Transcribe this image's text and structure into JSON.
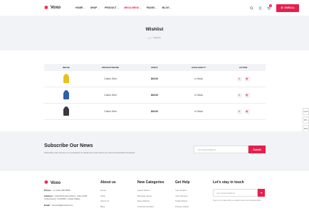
{
  "header": {
    "logo_text": "Voxo",
    "nav": [
      {
        "label": "Home"
      },
      {
        "label": "Shop"
      },
      {
        "label": "Product"
      },
      {
        "label": "Mega Menu"
      },
      {
        "label": "Pages"
      },
      {
        "label": "Blog"
      }
    ],
    "cart_count": "0",
    "enroll_label": "ENROLL"
  },
  "banner": {
    "title": "Wishlist",
    "breadcrumb_current": "Wishlist"
  },
  "table": {
    "headers": [
      "IMAGE",
      "PRODUCTNAME",
      "PRICE",
      "AVAILABILITY",
      "ACTION"
    ],
    "rows": [
      {
        "name": "Cotton Shirt",
        "price": "$40.00",
        "availability": "In Stock",
        "color": "#e7c21a"
      },
      {
        "name": "Cotton Shirt",
        "price": "$40.00",
        "availability": "In Stock",
        "color": "#2f5fa8"
      },
      {
        "name": "Cotton Shirt",
        "price": "$40.00",
        "availability": "In Stock",
        "color": "#3a3a3a"
      }
    ]
  },
  "side_tabs": [
    "Color",
    "RTL",
    "Dark"
  ],
  "subscribe": {
    "title": "Subscribe Our News",
    "description": "Subscribe and receive our newsletters to follow the news about our fresh and fantastic Products.",
    "placeholder": "Your Email Address",
    "button": "Submit"
  },
  "footer": {
    "logo_text": "Voxo",
    "phone_label": "Phone :",
    "phone": "+1 (123) 456-8596",
    "address_label": "Address :",
    "address": "1418 Riverwood Drive, Suite 3245 Cottonwood, CA 96052, United States",
    "email_label": "Email :",
    "email": "Voxo123@Gmail.Com",
    "about_title": "About us",
    "about_links": [
      "Home",
      "Shop",
      "About Us",
      "Blog"
    ],
    "categories_title": "New Categories",
    "categories_links": [
      "Latest Shoes",
      "Branded Jeans",
      "New Jackets",
      "Colorfull Hoodies"
    ],
    "help_title": "Get Help",
    "help_links": [
      "Your Orders",
      "Your Account",
      "Track Orders",
      "Privacy Notice"
    ],
    "touch_title": "Let's stay in touch",
    "touch_placeholder": "Your Email Address",
    "touch_note": "Keep up to date with our latest news and special offers."
  },
  "colors": {
    "accent": "#e91e4a",
    "banner_bg": "#f1f3f7"
  }
}
